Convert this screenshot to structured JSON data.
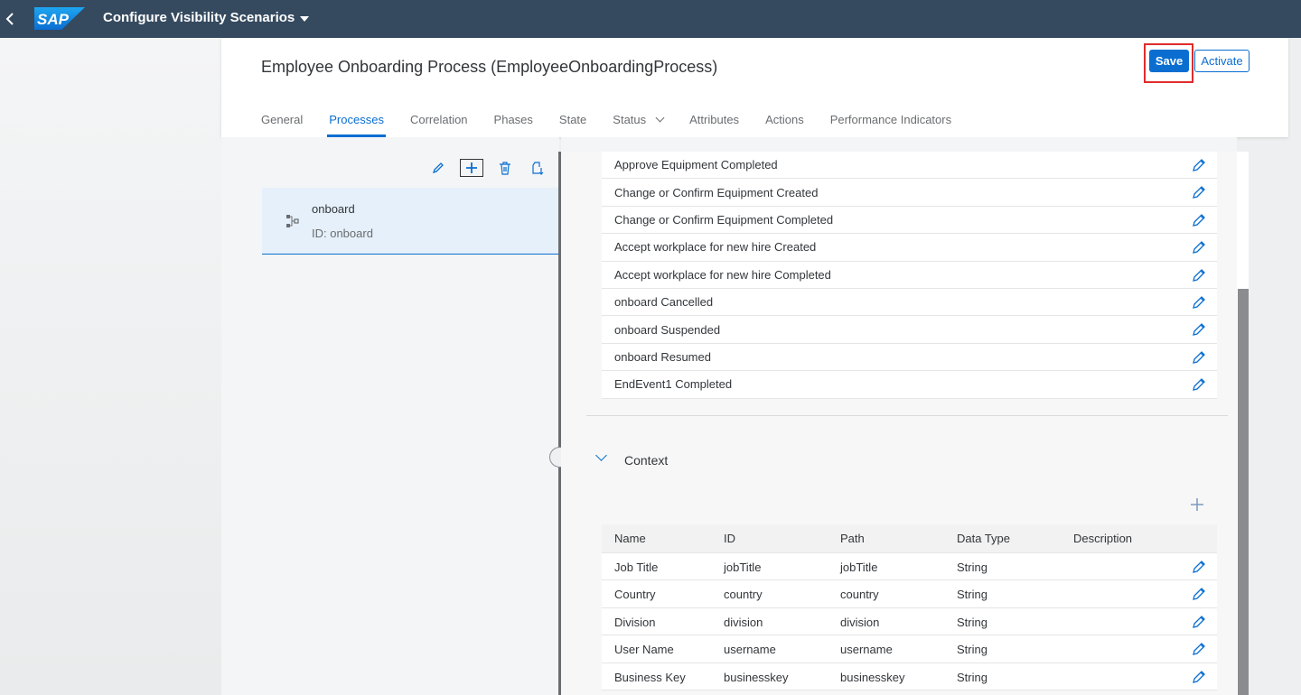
{
  "shell": {
    "back_icon": "chevron-left-icon",
    "logo_text": "SAP",
    "app_title": "Configure Visibility Scenarios"
  },
  "header": {
    "title": "Employee Onboarding Process (EmployeeOnboardingProcess)",
    "save_label": "Save",
    "activate_label": "Activate",
    "tabs": [
      {
        "label": "General"
      },
      {
        "label": "Processes"
      },
      {
        "label": "Correlation"
      },
      {
        "label": "Phases"
      },
      {
        "label": "State"
      },
      {
        "label": "Status"
      },
      {
        "label": "Attributes"
      },
      {
        "label": "Actions"
      },
      {
        "label": "Performance Indicators"
      }
    ],
    "active_tab": "Processes"
  },
  "left_pane": {
    "toolbar_icons": [
      "edit-icon",
      "add-icon",
      "delete-icon",
      "import-icon"
    ],
    "process": {
      "name": "onboard",
      "id_text": "ID: onboard"
    }
  },
  "events": [
    "Approve Equipment Completed",
    "Change or Confirm Equipment Created",
    "Change or Confirm Equipment Completed",
    "Accept workplace for new hire Created",
    "Accept workplace for new hire Completed",
    "onboard Cancelled",
    "onboard Suspended",
    "onboard Resumed",
    "EndEvent1 Completed"
  ],
  "context": {
    "title": "Context",
    "columns": [
      "Name",
      "ID",
      "Path",
      "Data Type",
      "Description"
    ],
    "rows": [
      [
        "Job Title",
        "jobTitle",
        "jobTitle",
        "String",
        ""
      ],
      [
        "Country",
        "country",
        "country",
        "String",
        ""
      ],
      [
        "Division",
        "division",
        "division",
        "String",
        ""
      ],
      [
        "User Name",
        "username",
        "username",
        "String",
        ""
      ],
      [
        "Business Key",
        "businesskey",
        "businesskey",
        "String",
        ""
      ]
    ]
  },
  "colors": {
    "shell_bg": "#354a5f",
    "accent": "#0a6ed1",
    "highlight_border": "#e02b2b"
  }
}
